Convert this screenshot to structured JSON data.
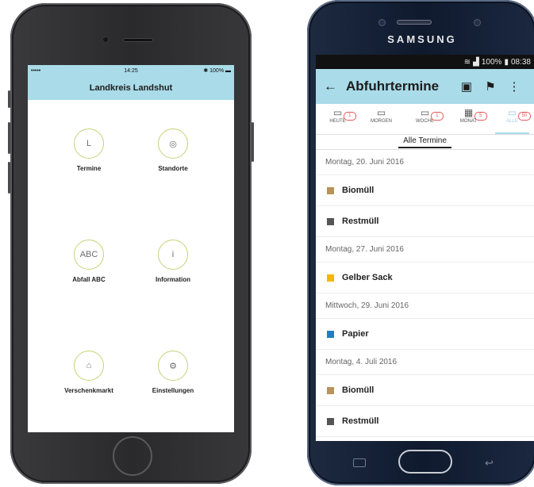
{
  "ios": {
    "status": {
      "signal": "••••• ",
      "time": "14:25",
      "battery": "100%"
    },
    "title": "Landkreis Landshut",
    "tiles": [
      {
        "label": "Termine",
        "icon_text": "L"
      },
      {
        "label": "Standorte",
        "icon_text": "◎"
      },
      {
        "label": "Abfall ABC",
        "icon_text": "ABC"
      },
      {
        "label": "Information",
        "icon_text": "i"
      },
      {
        "label": "Verschenkmarkt",
        "icon_text": "⌂"
      },
      {
        "label": "Einstellungen",
        "icon_text": "⚙"
      }
    ]
  },
  "samsung": {
    "brand": "SAMSUNG",
    "status": {
      "battery": "100%",
      "time": "08:38"
    },
    "toolbar": {
      "title": "Abfuhrtermine"
    },
    "tabs": [
      {
        "label": "HEUTE",
        "badge": "1"
      },
      {
        "label": "MORGEN",
        "badge": ""
      },
      {
        "label": "WOCHE",
        "badge": "1"
      },
      {
        "label": "MONAT",
        "badge": "5"
      },
      {
        "label": "ALLE",
        "badge": "50"
      }
    ],
    "subtab": "Alle Termine",
    "list": [
      {
        "type": "date",
        "text": "Montag, 20. Juni 2016"
      },
      {
        "type": "item",
        "text": "Biomüll",
        "color": "#b8935a"
      },
      {
        "type": "item",
        "text": "Restmüll",
        "color": "#555555"
      },
      {
        "type": "date",
        "text": "Montag, 27. Juni 2016"
      },
      {
        "type": "item",
        "text": "Gelber Sack",
        "color": "#f5b800"
      },
      {
        "type": "date",
        "text": "Mittwoch, 29. Juni 2016"
      },
      {
        "type": "item",
        "text": "Papier",
        "color": "#1f7fc1"
      },
      {
        "type": "date",
        "text": "Montag, 4. Juli 2016"
      },
      {
        "type": "item",
        "text": "Biomüll",
        "color": "#b8935a"
      },
      {
        "type": "item",
        "text": "Restmüll",
        "color": "#555555"
      }
    ]
  }
}
